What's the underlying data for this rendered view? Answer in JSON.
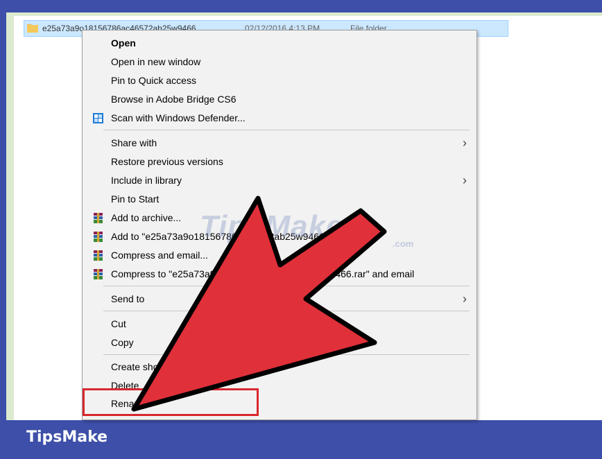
{
  "file_row": {
    "name": "e25a73a9o18156786ac46572ab25w9466",
    "date": "02/12/2016 4:13 PM",
    "type": "File folder"
  },
  "menu": {
    "items": [
      {
        "label": "Open"
      },
      {
        "label": "Open in new window"
      },
      {
        "label": "Pin to Quick access"
      },
      {
        "label": "Browse in Adobe Bridge CS6"
      },
      {
        "label": "Scan with Windows Defender..."
      },
      {
        "label": "Share with"
      },
      {
        "label": "Restore previous versions"
      },
      {
        "label": "Include in library"
      },
      {
        "label": "Pin to Start"
      },
      {
        "label": "Add to archive..."
      },
      {
        "label": "Add to \"e25a73a9o18156786ac46572ab25w9466.rar\""
      },
      {
        "label": "Compress and email..."
      },
      {
        "label": "Compress to \"e25a73a9o18156786ac46572ab25w9466.rar\" and email"
      },
      {
        "label": "Send to"
      },
      {
        "label": "Cut"
      },
      {
        "label": "Copy"
      },
      {
        "label": "Create shortcut"
      },
      {
        "label": "Delete"
      },
      {
        "label": "Rename"
      }
    ]
  },
  "watermark": {
    "text": "TipsMake",
    "suffix": ".com"
  },
  "footer": {
    "brand": "TipsMake"
  },
  "colors": {
    "highlight": "#d9272e",
    "arrow": "#e0303a",
    "footer": "#3d4fa8"
  }
}
